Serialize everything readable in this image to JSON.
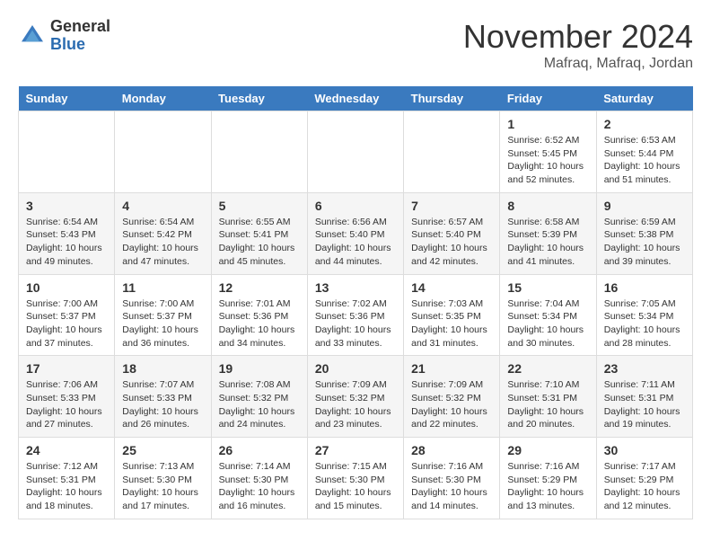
{
  "header": {
    "logo_line1": "General",
    "logo_line2": "Blue",
    "month": "November 2024",
    "location": "Mafraq, Mafraq, Jordan"
  },
  "weekdays": [
    "Sunday",
    "Monday",
    "Tuesday",
    "Wednesday",
    "Thursday",
    "Friday",
    "Saturday"
  ],
  "weeks": [
    [
      {
        "day": "",
        "info": ""
      },
      {
        "day": "",
        "info": ""
      },
      {
        "day": "",
        "info": ""
      },
      {
        "day": "",
        "info": ""
      },
      {
        "day": "",
        "info": ""
      },
      {
        "day": "1",
        "info": "Sunrise: 6:52 AM\nSunset: 5:45 PM\nDaylight: 10 hours and 52 minutes."
      },
      {
        "day": "2",
        "info": "Sunrise: 6:53 AM\nSunset: 5:44 PM\nDaylight: 10 hours and 51 minutes."
      }
    ],
    [
      {
        "day": "3",
        "info": "Sunrise: 6:54 AM\nSunset: 5:43 PM\nDaylight: 10 hours and 49 minutes."
      },
      {
        "day": "4",
        "info": "Sunrise: 6:54 AM\nSunset: 5:42 PM\nDaylight: 10 hours and 47 minutes."
      },
      {
        "day": "5",
        "info": "Sunrise: 6:55 AM\nSunset: 5:41 PM\nDaylight: 10 hours and 45 minutes."
      },
      {
        "day": "6",
        "info": "Sunrise: 6:56 AM\nSunset: 5:40 PM\nDaylight: 10 hours and 44 minutes."
      },
      {
        "day": "7",
        "info": "Sunrise: 6:57 AM\nSunset: 5:40 PM\nDaylight: 10 hours and 42 minutes."
      },
      {
        "day": "8",
        "info": "Sunrise: 6:58 AM\nSunset: 5:39 PM\nDaylight: 10 hours and 41 minutes."
      },
      {
        "day": "9",
        "info": "Sunrise: 6:59 AM\nSunset: 5:38 PM\nDaylight: 10 hours and 39 minutes."
      }
    ],
    [
      {
        "day": "10",
        "info": "Sunrise: 7:00 AM\nSunset: 5:37 PM\nDaylight: 10 hours and 37 minutes."
      },
      {
        "day": "11",
        "info": "Sunrise: 7:00 AM\nSunset: 5:37 PM\nDaylight: 10 hours and 36 minutes."
      },
      {
        "day": "12",
        "info": "Sunrise: 7:01 AM\nSunset: 5:36 PM\nDaylight: 10 hours and 34 minutes."
      },
      {
        "day": "13",
        "info": "Sunrise: 7:02 AM\nSunset: 5:36 PM\nDaylight: 10 hours and 33 minutes."
      },
      {
        "day": "14",
        "info": "Sunrise: 7:03 AM\nSunset: 5:35 PM\nDaylight: 10 hours and 31 minutes."
      },
      {
        "day": "15",
        "info": "Sunrise: 7:04 AM\nSunset: 5:34 PM\nDaylight: 10 hours and 30 minutes."
      },
      {
        "day": "16",
        "info": "Sunrise: 7:05 AM\nSunset: 5:34 PM\nDaylight: 10 hours and 28 minutes."
      }
    ],
    [
      {
        "day": "17",
        "info": "Sunrise: 7:06 AM\nSunset: 5:33 PM\nDaylight: 10 hours and 27 minutes."
      },
      {
        "day": "18",
        "info": "Sunrise: 7:07 AM\nSunset: 5:33 PM\nDaylight: 10 hours and 26 minutes."
      },
      {
        "day": "19",
        "info": "Sunrise: 7:08 AM\nSunset: 5:32 PM\nDaylight: 10 hours and 24 minutes."
      },
      {
        "day": "20",
        "info": "Sunrise: 7:09 AM\nSunset: 5:32 PM\nDaylight: 10 hours and 23 minutes."
      },
      {
        "day": "21",
        "info": "Sunrise: 7:09 AM\nSunset: 5:32 PM\nDaylight: 10 hours and 22 minutes."
      },
      {
        "day": "22",
        "info": "Sunrise: 7:10 AM\nSunset: 5:31 PM\nDaylight: 10 hours and 20 minutes."
      },
      {
        "day": "23",
        "info": "Sunrise: 7:11 AM\nSunset: 5:31 PM\nDaylight: 10 hours and 19 minutes."
      }
    ],
    [
      {
        "day": "24",
        "info": "Sunrise: 7:12 AM\nSunset: 5:31 PM\nDaylight: 10 hours and 18 minutes."
      },
      {
        "day": "25",
        "info": "Sunrise: 7:13 AM\nSunset: 5:30 PM\nDaylight: 10 hours and 17 minutes."
      },
      {
        "day": "26",
        "info": "Sunrise: 7:14 AM\nSunset: 5:30 PM\nDaylight: 10 hours and 16 minutes."
      },
      {
        "day": "27",
        "info": "Sunrise: 7:15 AM\nSunset: 5:30 PM\nDaylight: 10 hours and 15 minutes."
      },
      {
        "day": "28",
        "info": "Sunrise: 7:16 AM\nSunset: 5:30 PM\nDaylight: 10 hours and 14 minutes."
      },
      {
        "day": "29",
        "info": "Sunrise: 7:16 AM\nSunset: 5:29 PM\nDaylight: 10 hours and 13 minutes."
      },
      {
        "day": "30",
        "info": "Sunrise: 7:17 AM\nSunset: 5:29 PM\nDaylight: 10 hours and 12 minutes."
      }
    ]
  ]
}
